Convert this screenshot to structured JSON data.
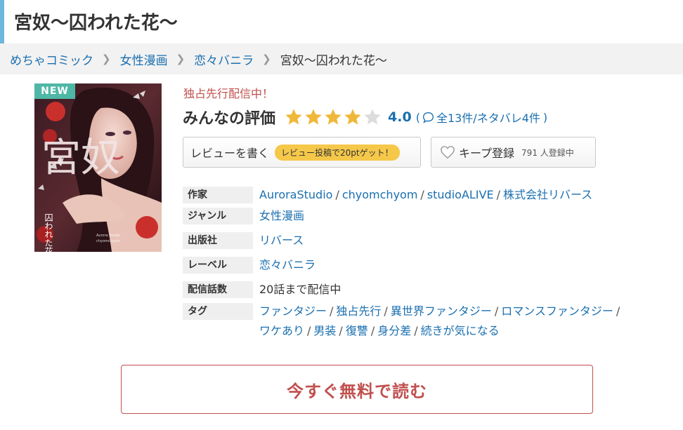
{
  "page": {
    "title": "宮奴～囚われた花～"
  },
  "breadcrumb": [
    {
      "label": "めちゃコミック"
    },
    {
      "label": "女性漫画"
    },
    {
      "label": "恋々バニラ"
    }
  ],
  "breadcrumb_current": "宮奴～囚われた花～",
  "cover": {
    "badge": "NEW",
    "title_art": "宮奴",
    "subtitle_art": "囚われた花",
    "credit_art_1": "Aurora Studio",
    "credit_art_2": "chyomchyom"
  },
  "status": "独占先行配信中！",
  "rating": {
    "label": "みんなの評価",
    "value": "4.0",
    "stars": 4,
    "max_stars": 5,
    "open_paren": "(",
    "count_text": "全13件/ネタバレ4件",
    "close_paren": ")"
  },
  "review_button": {
    "label": "レビューを書く",
    "badge": "レビュー投稿で20ptゲット！"
  },
  "keep_button": {
    "label": "キープ登録",
    "count": "791 人登録中"
  },
  "info": {
    "author": {
      "label": "作家",
      "values": [
        "AuroraStudio",
        "chyomchyom",
        "studioALIVE",
        "株式会社リバース"
      ]
    },
    "genre": {
      "label": "ジャンル",
      "value": "女性漫画"
    },
    "publisher": {
      "label": "出版社",
      "value": "リバース"
    },
    "label_row": {
      "label": "レーベル",
      "value": "恋々バニラ"
    },
    "episodes": {
      "label": "配信話数",
      "value": "20話まで配信中"
    },
    "tags": {
      "label": "タグ",
      "line1": [
        "ファンタジー",
        "独占先行",
        "異世界ファンタジー",
        "ロマンスファンタジー"
      ],
      "line2": [
        "ワケあり",
        "男装",
        "復讐",
        "身分差",
        "続きが気になる"
      ]
    }
  },
  "separator": "/",
  "cta": {
    "label": "今すぐ無料で読む"
  },
  "colors": {
    "link": "#1a6fb0",
    "accent_red": "#c0504d",
    "star": "#f0b83a",
    "badge_teal": "#4fb7a6",
    "title_accent": "#6fb6dc"
  },
  "icons": [
    "chevron-right-icon",
    "star-icon",
    "comment-bubble-icon",
    "heart-icon"
  ]
}
